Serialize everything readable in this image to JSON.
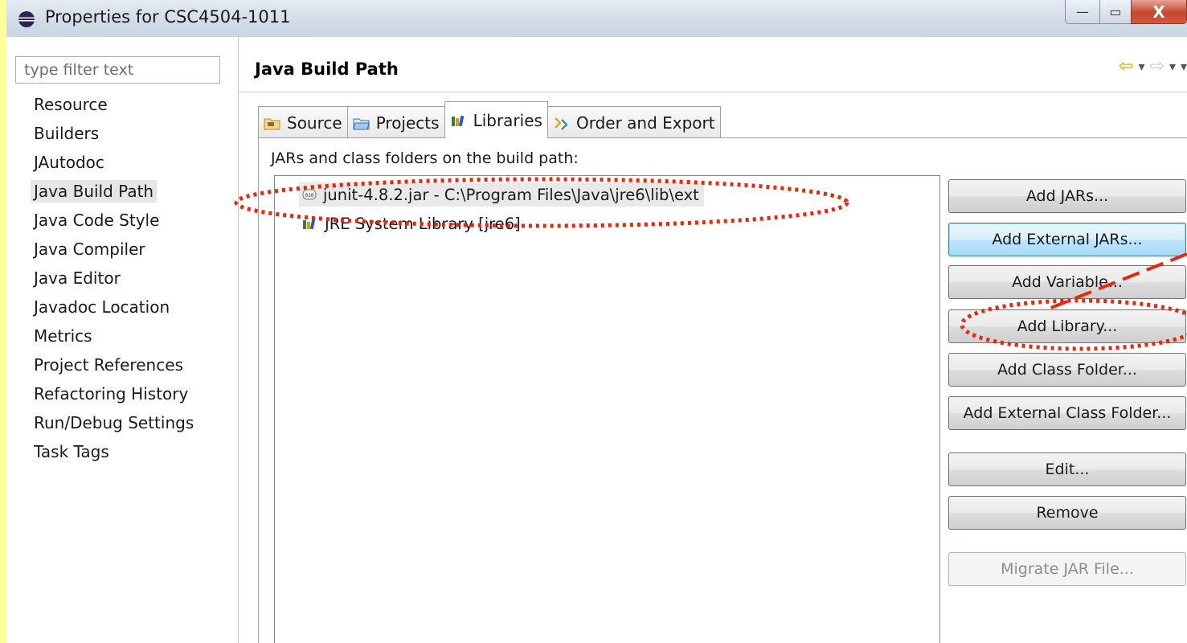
{
  "window": {
    "title": "Properties for CSC4504-1011",
    "min_label": "—",
    "max_label": "▭",
    "close_label": "X"
  },
  "filter": {
    "placeholder": "type filter text"
  },
  "nav": {
    "items": [
      "Resource",
      "Builders",
      "JAutodoc",
      "Java Build Path",
      "Java Code Style",
      "Java Compiler",
      "Java Editor",
      "Javadoc Location",
      "Metrics",
      "Project References",
      "Refactoring History",
      "Run/Debug Settings",
      "Task Tags"
    ],
    "selected": "Java Build Path"
  },
  "page": {
    "title": "Java Build Path"
  },
  "tabs": [
    {
      "label": "Source",
      "icon": "source-folder-icon"
    },
    {
      "label": "Projects",
      "icon": "projects-icon"
    },
    {
      "label": "Libraries",
      "icon": "libraries-icon"
    },
    {
      "label": "Order and Export",
      "icon": "order-export-icon"
    }
  ],
  "active_tab": "Libraries",
  "section_label": "JARs and class folders on the build path:",
  "libraries": [
    {
      "label": "junit-4.8.2.jar - C:\\Program Files\\Java\\jre6\\lib\\ext",
      "icon": "jar-icon"
    },
    {
      "label": "JRE System Library [jre6]",
      "icon": "library-icon"
    }
  ],
  "buttons": {
    "add_jars": "Add JARs...",
    "add_external_jars": "Add External JARs...",
    "add_variable": "Add Variable...",
    "add_library": "Add Library...",
    "add_class_folder": "Add Class Folder...",
    "add_external_class_folder": "Add External Class Folder...",
    "edit": "Edit...",
    "remove": "Remove",
    "migrate_jar": "Migrate JAR File..."
  },
  "colors": {
    "background": "#ffff99",
    "annotation": "#e8280a",
    "focus_border": "#3c7fb1"
  }
}
